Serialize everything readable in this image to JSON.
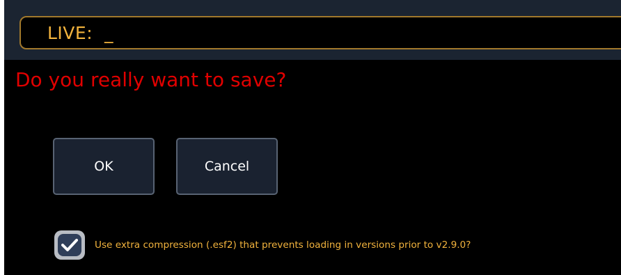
{
  "command_line": {
    "text": "LIVE:  _"
  },
  "dialog": {
    "question": "Do you really want to save?",
    "ok_label": "OK",
    "cancel_label": "Cancel",
    "checkbox": {
      "label": "Use extra compression (.esf2) that prevents loading in versions prior to v2.9.0?",
      "checked": true,
      "icon": "checkmark-icon"
    }
  },
  "colors": {
    "background": "#000000",
    "topbar": "#1b2431",
    "command_border": "#a2792c",
    "command_text": "#f2b33d",
    "question_text": "#e10000",
    "button_fill": "#1a2230",
    "button_border": "#586373",
    "checkbox_label": "#f2b33d"
  }
}
